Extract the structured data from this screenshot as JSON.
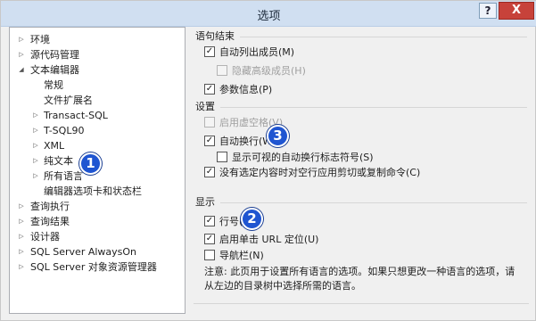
{
  "window": {
    "title": "选项",
    "help_label": "?",
    "close_label": "X"
  },
  "tree": [
    {
      "label": "环境",
      "arrow": "▷"
    },
    {
      "label": "源代码管理",
      "arrow": "▷"
    },
    {
      "label": "文本编辑器",
      "arrow": "◢"
    },
    {
      "label": "常规",
      "arrow": ""
    },
    {
      "label": "文件扩展名",
      "arrow": ""
    },
    {
      "label": "Transact-SQL",
      "arrow": "▷"
    },
    {
      "label": "T-SQL90",
      "arrow": "▷"
    },
    {
      "label": "XML",
      "arrow": "▷"
    },
    {
      "label": "纯文本",
      "arrow": "▷"
    },
    {
      "label": "所有语言",
      "arrow": "▷"
    },
    {
      "label": "编辑器选项卡和状态栏",
      "arrow": ""
    },
    {
      "label": "查询执行",
      "arrow": "▷"
    },
    {
      "label": "查询结果",
      "arrow": "▷"
    },
    {
      "label": "设计器",
      "arrow": "▷"
    },
    {
      "label": "SQL Server AlwaysOn",
      "arrow": "▷"
    },
    {
      "label": "SQL Server 对象资源管理器",
      "arrow": "▷"
    }
  ],
  "sections": {
    "statement_completion": "语句结束",
    "settings": "设置",
    "display": "显示"
  },
  "options": {
    "auto_list_members": {
      "label": "自动列出成员(M)",
      "checked": true
    },
    "hide_advanced_members": {
      "label": "隐藏高级成员(H)",
      "checked": false
    },
    "parameter_info": {
      "label": "参数信息(P)",
      "checked": true
    },
    "enable_virtual_space": {
      "label": "启用虚空格(V)",
      "checked": false
    },
    "word_wrap": {
      "label": "自动换行(W)",
      "checked": true
    },
    "show_wrap_glyphs": {
      "label": "显示可视的自动换行标志符号(S)",
      "checked": false
    },
    "copy_empty_line": {
      "label": "没有选定内容时对空行应用剪切或复制命令(C)",
      "checked": true
    },
    "line_numbers": {
      "label": "行号(L)",
      "checked": true
    },
    "url_navigation": {
      "label": "启用单击 URL 定位(U)",
      "checked": true
    },
    "navigation_bar": {
      "label": "导航栏(N)",
      "checked": false
    }
  },
  "note": "注意: 此页用于设置所有语言的选项。如果只想更改一种语言的选项，请从左边的目录树中选择所需的语言。",
  "callouts": [
    "1",
    "2",
    "3"
  ],
  "colors": {
    "badge": "#1f55d1",
    "titlebar": "#d0dff1",
    "close": "#c7423a"
  }
}
